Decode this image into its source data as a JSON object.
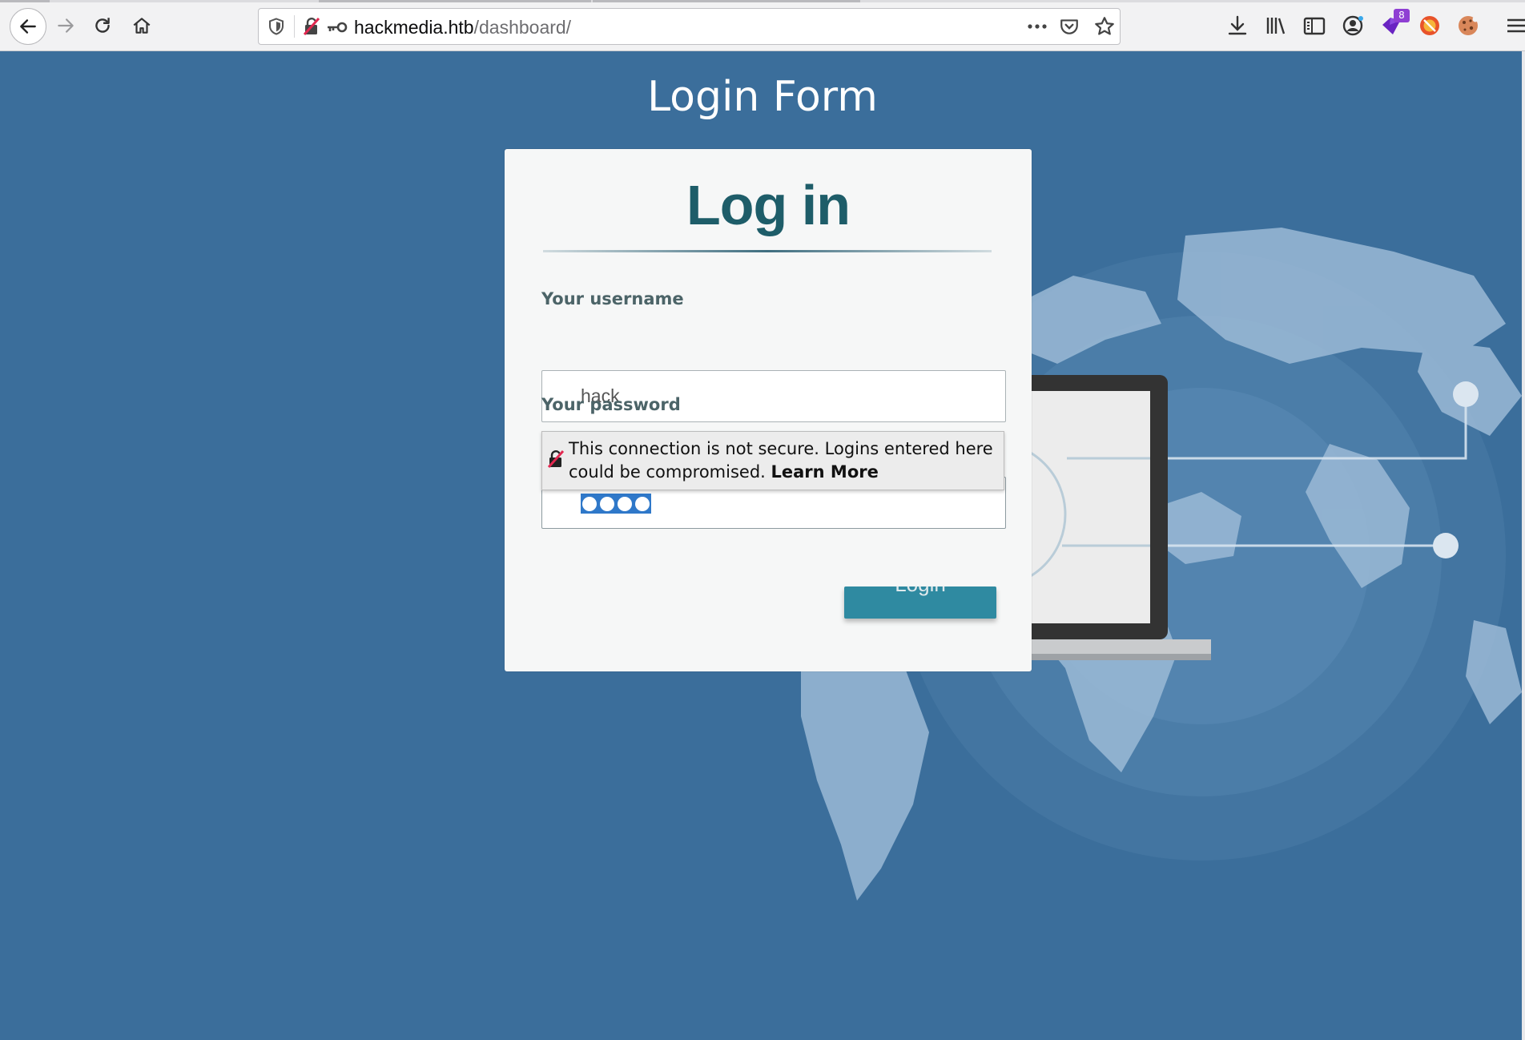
{
  "browser": {
    "url_host": "hackmedia.htb",
    "url_path": "/dashboard/",
    "extension_badge": "8",
    "icons": [
      "back-icon",
      "forward-icon",
      "reload-icon",
      "home-icon",
      "shield-icon",
      "insecure-lock-icon",
      "key-icon",
      "more-icon",
      "pocket-icon",
      "star-icon",
      "download-icon",
      "library-icon",
      "sidebar-icon",
      "account-icon",
      "extension-icon",
      "blocker-icon",
      "cookie-icon",
      "menu-icon"
    ]
  },
  "page": {
    "title": "Login Form"
  },
  "card": {
    "heading": "Log in",
    "username_label": "Your username",
    "username_value": "hack",
    "password_label": "Your password",
    "password_length": 4,
    "login_label": "Login"
  },
  "warning": {
    "text": "This connection is not secure. Logins entered here could be compromised.",
    "link": "Learn More"
  },
  "colors": {
    "page_bg": "#3b6e9b",
    "heading": "#1e5d69",
    "button": "#2f8aa1",
    "password_selection": "#2f78c9"
  }
}
